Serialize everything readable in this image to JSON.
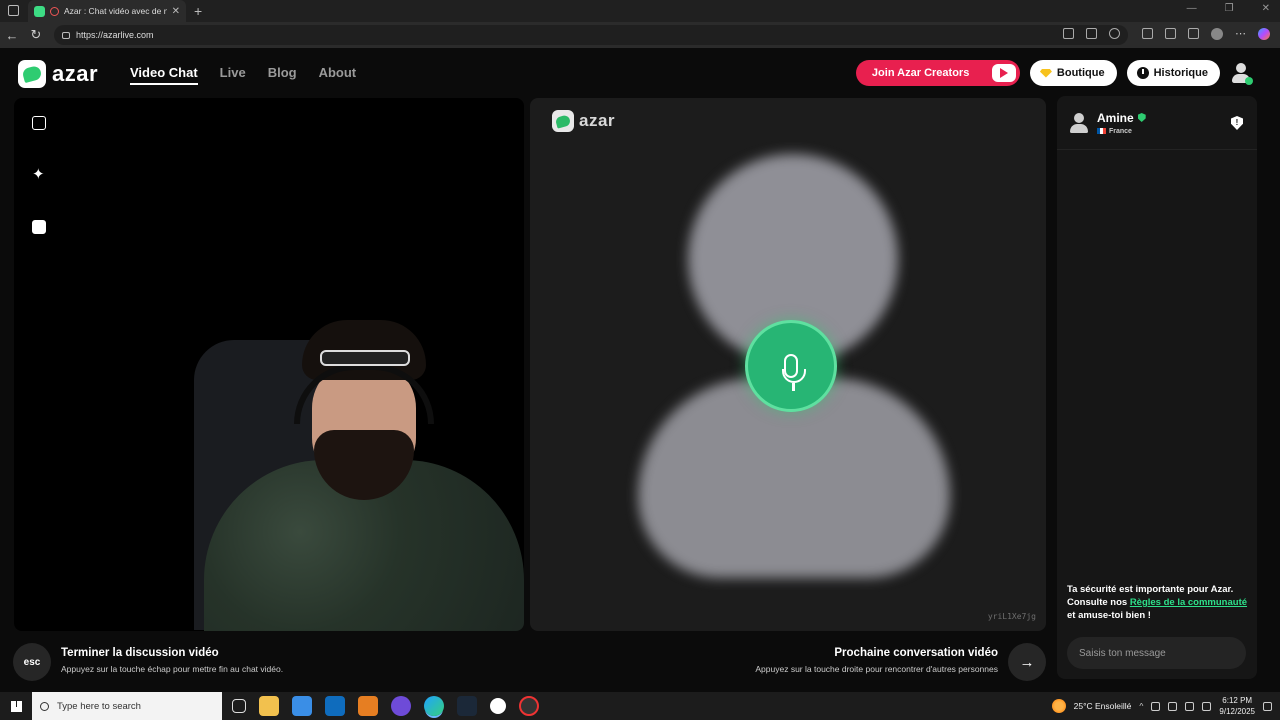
{
  "browser": {
    "tab_title": "Azar : Chat vidéo avec de no",
    "url": "https://azarlive.com"
  },
  "header": {
    "brand": "azar",
    "nav": [
      {
        "label": "Video Chat",
        "active": true
      },
      {
        "label": "Live",
        "active": false
      },
      {
        "label": "Blog",
        "active": false
      },
      {
        "label": "About",
        "active": false
      }
    ],
    "creators_label": "Join Azar Creators",
    "boutique_label": "Boutique",
    "historique_label": "Historique"
  },
  "remote": {
    "watermark": "azar",
    "session_id": "yriL1Xe7jg"
  },
  "chat": {
    "peer_name": "Amine",
    "peer_country": "France",
    "safety_prefix": "Ta sécurité est importante pour Azar. Consulte nos ",
    "safety_link": "Règles de la communauté",
    "safety_suffix": " et amuse-toi bien !",
    "input_placeholder": "Saisis ton message"
  },
  "actions": {
    "esc_label": "esc",
    "end_title": "Terminer la discussion vidéo",
    "end_sub": "Appuyez sur la touche échap pour mettre fin au chat vidéo.",
    "next_title": "Prochaine conversation vidéo",
    "next_sub": "Appuyez sur la touche droite pour rencontrer d'autres personnes",
    "next_icon": "→"
  },
  "taskbar": {
    "search_placeholder": "Type here to search",
    "weather": "25°C  Ensoleillé",
    "time": "6:12 PM",
    "date": "9/12/2025"
  },
  "colors": {
    "brand_green": "#2ecc71",
    "creators_red": "#e8204f",
    "link_green": "#2ee08a"
  }
}
